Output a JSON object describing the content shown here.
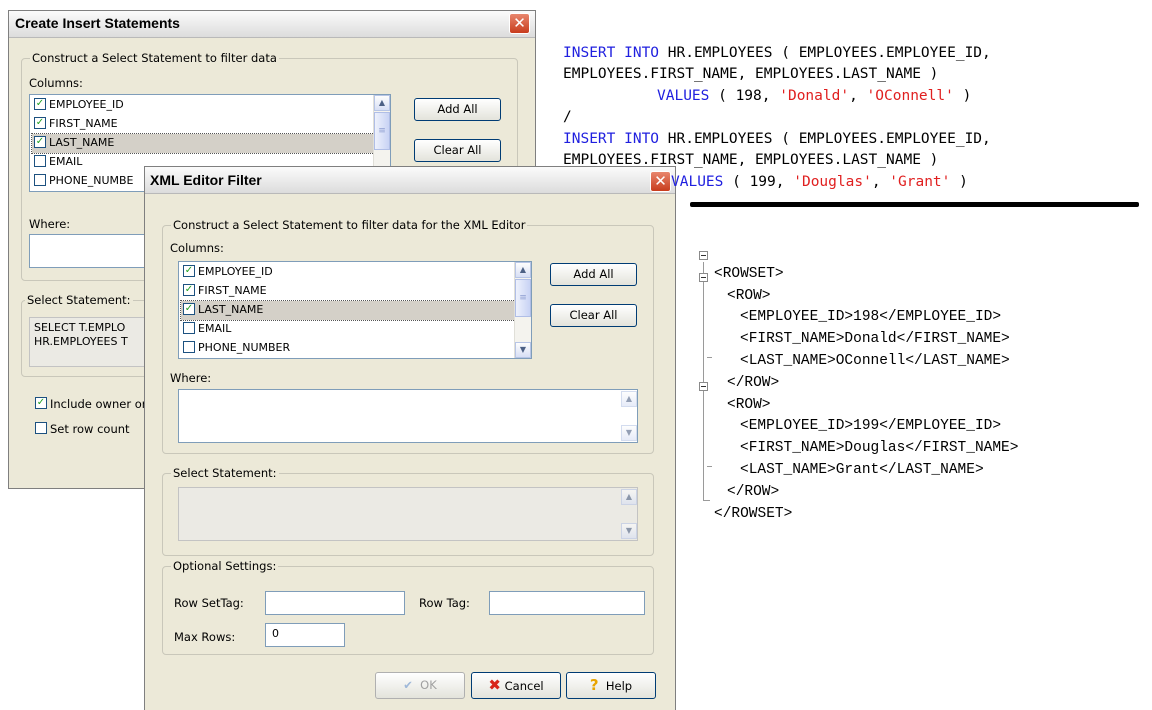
{
  "insert_dialog": {
    "title": "Create Insert Statements",
    "group_filter_label": "Construct a Select Statement to filter data",
    "columns_label": "Columns:",
    "columns": [
      {
        "name": "EMPLOYEE_ID",
        "checked": true
      },
      {
        "name": "FIRST_NAME",
        "checked": true
      },
      {
        "name": "LAST_NAME",
        "checked": true
      },
      {
        "name": "EMAIL",
        "checked": false
      },
      {
        "name": "PHONE_NUMBE",
        "checked": false
      }
    ],
    "add_all": "Add All",
    "clear_all": "Clear All",
    "where_label": "Where:",
    "select_statement_label": "Select Statement:",
    "select_statement_lines": [
      "SELECT T.EMPLO",
      "HR.EMPLOYEES T"
    ],
    "include_owner_label": "Include owner or",
    "include_owner_checked": true,
    "set_row_count_label": "Set row count",
    "set_row_count_checked": false
  },
  "xml_dialog": {
    "title": "XML Editor Filter",
    "group_filter_label": "Construct a Select Statement to filter data for the XML Editor",
    "columns_label": "Columns:",
    "columns": [
      {
        "name": "EMPLOYEE_ID",
        "checked": true
      },
      {
        "name": "FIRST_NAME",
        "checked": true
      },
      {
        "name": "LAST_NAME",
        "checked": true
      },
      {
        "name": "EMAIL",
        "checked": false
      },
      {
        "name": "PHONE_NUMBER",
        "checked": false
      }
    ],
    "add_all": "Add All",
    "clear_all": "Clear All",
    "where_label": "Where:",
    "select_statement_label": "Select Statement:",
    "optional_settings_label": "Optional Settings:",
    "row_set_tag_label": "Row SetTag:",
    "row_set_tag_value": "",
    "row_tag_label": "Row Tag:",
    "row_tag_value": "",
    "max_rows_label": "Max Rows:",
    "max_rows_value": "0",
    "ok_label": "OK",
    "cancel_label": "Cancel",
    "help_label": "Help"
  },
  "sql_output": {
    "statements": [
      {
        "line1_kw": "INSERT INTO",
        "line1_rest": " HR.EMPLOYEES ( EMPLOYEES.EMPLOYEE_ID,",
        "line2": "EMPLOYEES.FIRST_NAME, EMPLOYEES.LAST_NAME )",
        "values_kw": "VALUES",
        "values_open": " ( 198, ",
        "str1": "'Donald'",
        "sep": ", ",
        "str2": "'OConnell'",
        "values_close": " )"
      },
      {
        "line1_kw": "INSERT INTO",
        "line1_rest": " HR.EMPLOYEES ( EMPLOYEES.EMPLOYEE_ID,",
        "line2": "EMPLOYEES.FIRST_NAME, EMPLOYEES.LAST_NAME )",
        "values_kw": "VALUES",
        "values_open": " ( 199, ",
        "str1": "'Douglas'",
        "sep": ", ",
        "str2": "'Grant'",
        "values_close": " )"
      }
    ],
    "separator": "/"
  },
  "xml_output": {
    "lines": [
      "<ROWSET>",
      "<ROW>",
      "<EMPLOYEE_ID>198</EMPLOYEE_ID>",
      "<FIRST_NAME>Donald</FIRST_NAME>",
      "<LAST_NAME>OConnell</LAST_NAME>",
      "</ROW>",
      "<ROW>",
      "<EMPLOYEE_ID>199</EMPLOYEE_ID>",
      "<FIRST_NAME>Douglas</FIRST_NAME>",
      "<LAST_NAME>Grant</LAST_NAME>",
      "</ROW>",
      "</ROWSET>"
    ]
  },
  "colors": {
    "keyword": "#1f1fdf",
    "string": "#e02020",
    "dialog_bg": "#ece9d8"
  }
}
